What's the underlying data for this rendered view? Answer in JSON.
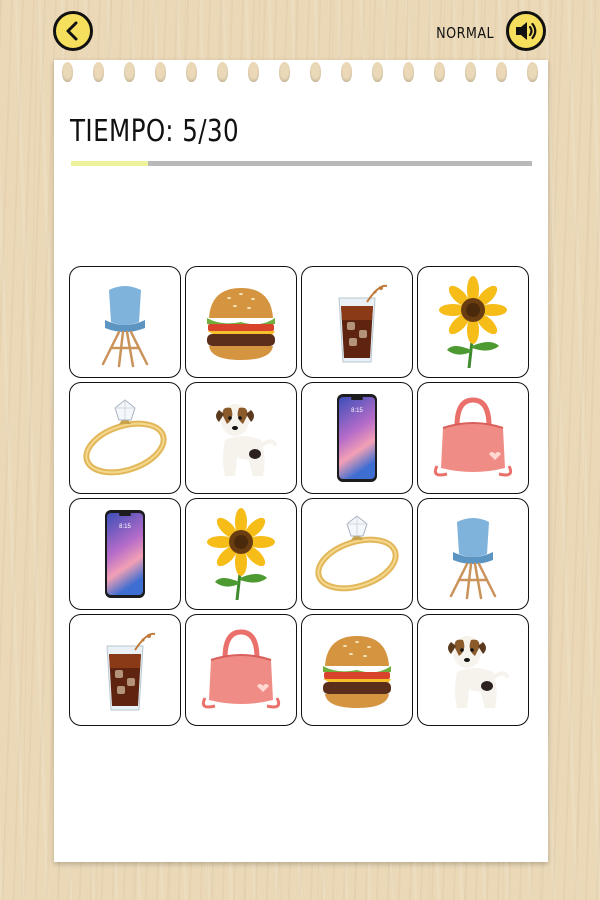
{
  "header": {
    "mode_label": "NORMAL",
    "back_icon": "chevron-left-icon",
    "sound_icon": "speaker-icon"
  },
  "game": {
    "time_label": "TIEMPO: 5/30",
    "timer_elapsed": 5,
    "timer_total": 30,
    "progress_color": "#eef29a",
    "track_color": "#b9b9b9",
    "accent_color": "#f7df5e",
    "cards": [
      "chair",
      "burger",
      "cola",
      "sunflower",
      "ring",
      "dog",
      "phone",
      "handbag",
      "phone",
      "sunflower",
      "ring",
      "chair",
      "cola",
      "handbag",
      "burger",
      "dog"
    ]
  },
  "phone_time": "8:15"
}
